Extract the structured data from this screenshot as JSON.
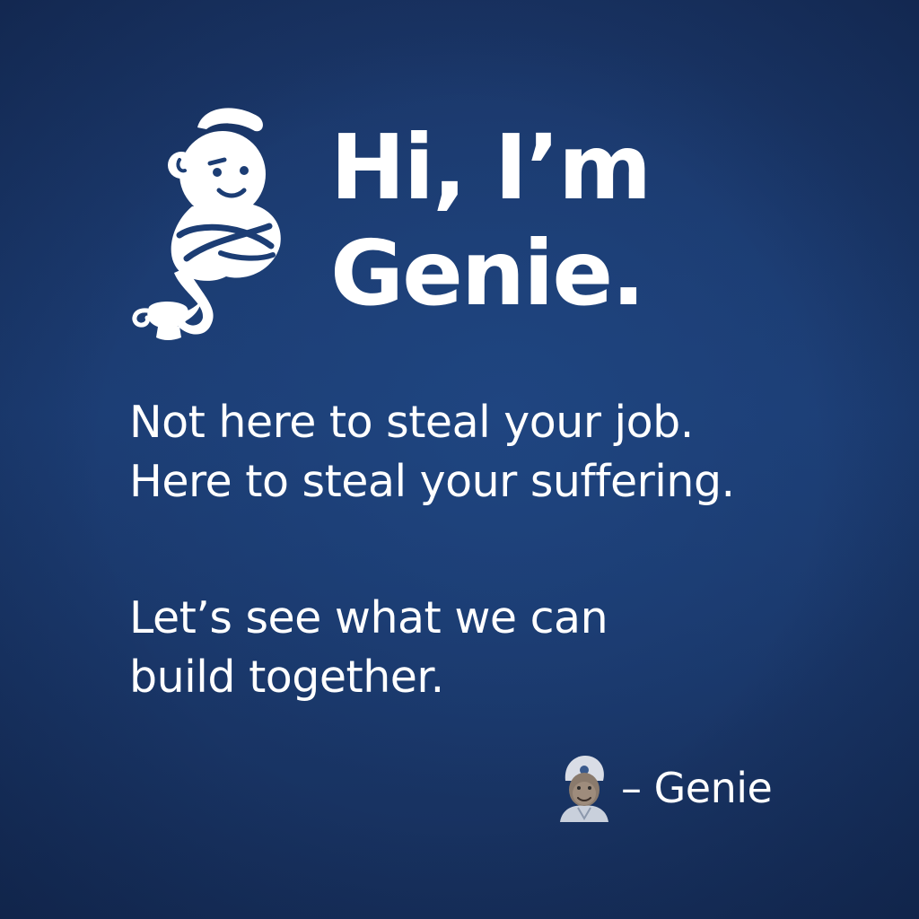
{
  "headline": {
    "line1": "Hi, I’m",
    "line2": "Genie."
  },
  "tagline": {
    "line1": "Not here to steal your job.",
    "line2": "Here to steal your suffering."
  },
  "closing": {
    "line1": "Let’s see what we can",
    "line2": "build together."
  },
  "signature": {
    "name": "– Genie"
  },
  "colors": {
    "background": "#1c3d74",
    "text": "#ffffff"
  },
  "icons": {
    "main": "genie-with-lamp-icon",
    "avatar": "genie-avatar"
  }
}
